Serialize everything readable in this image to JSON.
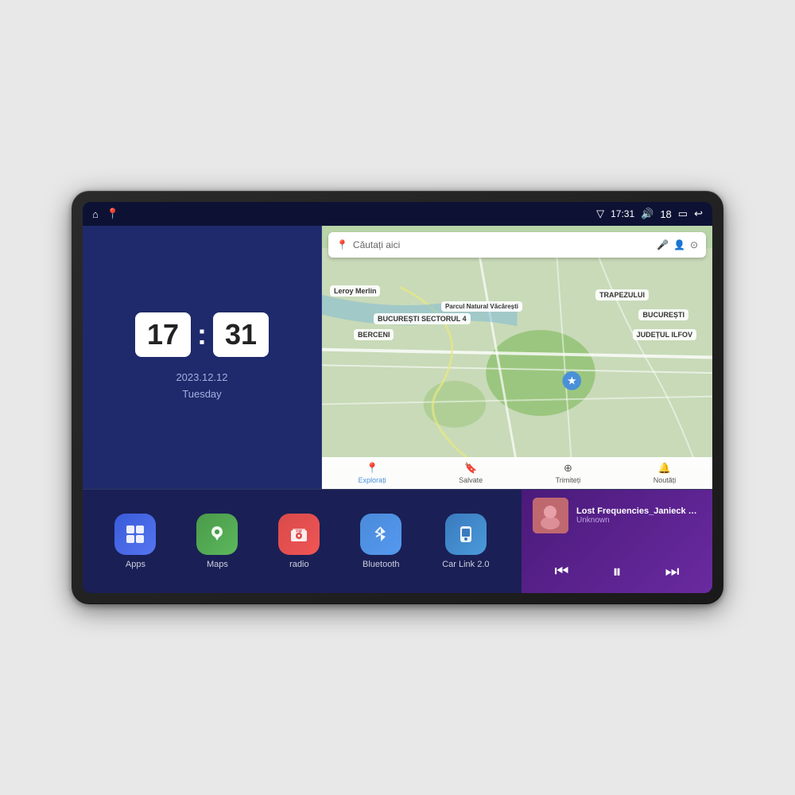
{
  "device": {
    "screen_bg": "#1a1f4a"
  },
  "status_bar": {
    "signal_icon": "▽",
    "time": "17:31",
    "volume_icon": "🔊",
    "battery_level": "18",
    "battery_icon": "▭",
    "back_icon": "↩"
  },
  "clock": {
    "hour": "17",
    "minute": "31",
    "date": "2023.12.12",
    "day": "Tuesday"
  },
  "map": {
    "search_placeholder": "Căutați aici",
    "location1": "Parcul Natural Văcărești",
    "location2": "Leroy Merlin",
    "location3": "BUCUREȘTI",
    "location4": "JUDEȚUL ILFOV",
    "location5": "TRAPEZULUI",
    "location6": "BERCENI",
    "location7": "BUCUREȘTI SECTORUL 4",
    "nav_items": [
      {
        "label": "Explorați",
        "icon": "📍",
        "active": true
      },
      {
        "label": "Salvate",
        "icon": "🔖",
        "active": false
      },
      {
        "label": "Trimiteți",
        "icon": "⊕",
        "active": false
      },
      {
        "label": "Noutăți",
        "icon": "🔔",
        "active": false
      }
    ]
  },
  "apps": [
    {
      "id": "apps",
      "label": "Apps",
      "icon": "⊞",
      "class": "apps"
    },
    {
      "id": "maps",
      "label": "Maps",
      "icon": "📍",
      "class": "maps"
    },
    {
      "id": "radio",
      "label": "radio",
      "icon": "📻",
      "class": "radio"
    },
    {
      "id": "bluetooth",
      "label": "Bluetooth",
      "icon": "⬡",
      "class": "bluetooth"
    },
    {
      "id": "carlink",
      "label": "Car Link 2.0",
      "icon": "📱",
      "class": "carlink"
    }
  ],
  "music": {
    "title": "Lost Frequencies_Janieck Devy-...",
    "artist": "Unknown",
    "prev_icon": "⏮",
    "play_icon": "⏸",
    "next_icon": "⏭"
  }
}
